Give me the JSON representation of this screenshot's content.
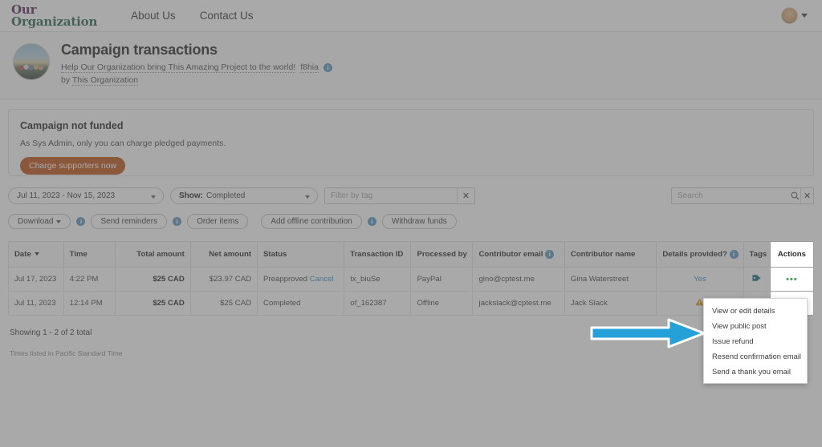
{
  "topnav": {
    "brand_line1": "Our",
    "brand_line2": "Organization",
    "links": [
      {
        "label": "About Us"
      },
      {
        "label": "Contact Us"
      }
    ],
    "avatar_name": "user-avatar"
  },
  "campaign": {
    "title": "Campaign transactions",
    "tagline": "Help Our Organization bring This Amazing Project to the world!",
    "campaign_id": "f8hia",
    "by_prefix": "by ",
    "org_name": "This Organization"
  },
  "notice": {
    "title": "Campaign not funded",
    "text": "As Sys Admin, only you can charge pledged payments.",
    "button_label": "Charge supporters now",
    "button_color": "#c2561d"
  },
  "filters": {
    "date_range": "Jul 11, 2023 - Nov 15, 2023",
    "show_label": "Show:",
    "show_value": "Completed",
    "tag_placeholder": "Filter by tag",
    "tag_value": "",
    "clear_tag_label": "✕",
    "search_placeholder": "Search",
    "search_value": "",
    "clear_search_label": "✕"
  },
  "actions_bar": {
    "buttons": [
      {
        "label": "Download",
        "has_caret": true,
        "has_info": true
      },
      {
        "label": "Send reminders",
        "has_caret": false,
        "has_info": true
      },
      {
        "label": "Order items",
        "has_caret": false,
        "has_info": false
      },
      {
        "label": "Add offline contribution",
        "has_caret": false,
        "has_info": true
      },
      {
        "label": "Withdraw funds",
        "has_caret": false,
        "has_info": false
      }
    ]
  },
  "table": {
    "columns": [
      "Date",
      "Time",
      "Total amount",
      "Net amount",
      "Status",
      "Transaction ID",
      "Processed by",
      "Contributor email",
      "Contributor name",
      "Details provided?",
      "Tags",
      "Actions"
    ],
    "rows": [
      {
        "date": "Jul 17, 2023",
        "time": "4:22 PM",
        "total_amount": "$25 CAD",
        "net_amount": "$23.97 CAD",
        "status": "Preapproved",
        "status_action": "Cancel",
        "transaction_id": "tx_biuSe",
        "processed_by": "PayPal",
        "contributor_email": "gino@cptest.me",
        "contributor_name": "Gina Waterstreet",
        "details_provided": "Yes",
        "tags_icon": "tag-icon",
        "actions_icon": "ellipsis-icon"
      },
      {
        "date": "Jul 11, 2023",
        "time": "12:14 PM",
        "total_amount": "$25 CAD",
        "net_amount": "$25 CAD",
        "status": "Completed",
        "status_action": "",
        "transaction_id": "of_162387",
        "processed_by": "Offline",
        "contributor_email": "jackslack@cptest.me",
        "contributor_name": "Jack Slack",
        "details_provided": "",
        "details_icon": "warning-icon",
        "tags_icon": "",
        "actions_icon": "chevron-right-icon"
      }
    ],
    "showing_text": "Showing 1 - 2 of 2 total",
    "timezone_note": "Times listed in Pacific Standard Time"
  },
  "actions_menu": {
    "items": [
      {
        "label": "View or edit details"
      },
      {
        "label": "View public post"
      },
      {
        "label": "Issue refund"
      },
      {
        "label": "Resend confirmation email"
      },
      {
        "label": "Send a thank you email"
      }
    ]
  },
  "annotation": {
    "arrow_color": "#26A0D8",
    "points_at": "Issue refund"
  }
}
